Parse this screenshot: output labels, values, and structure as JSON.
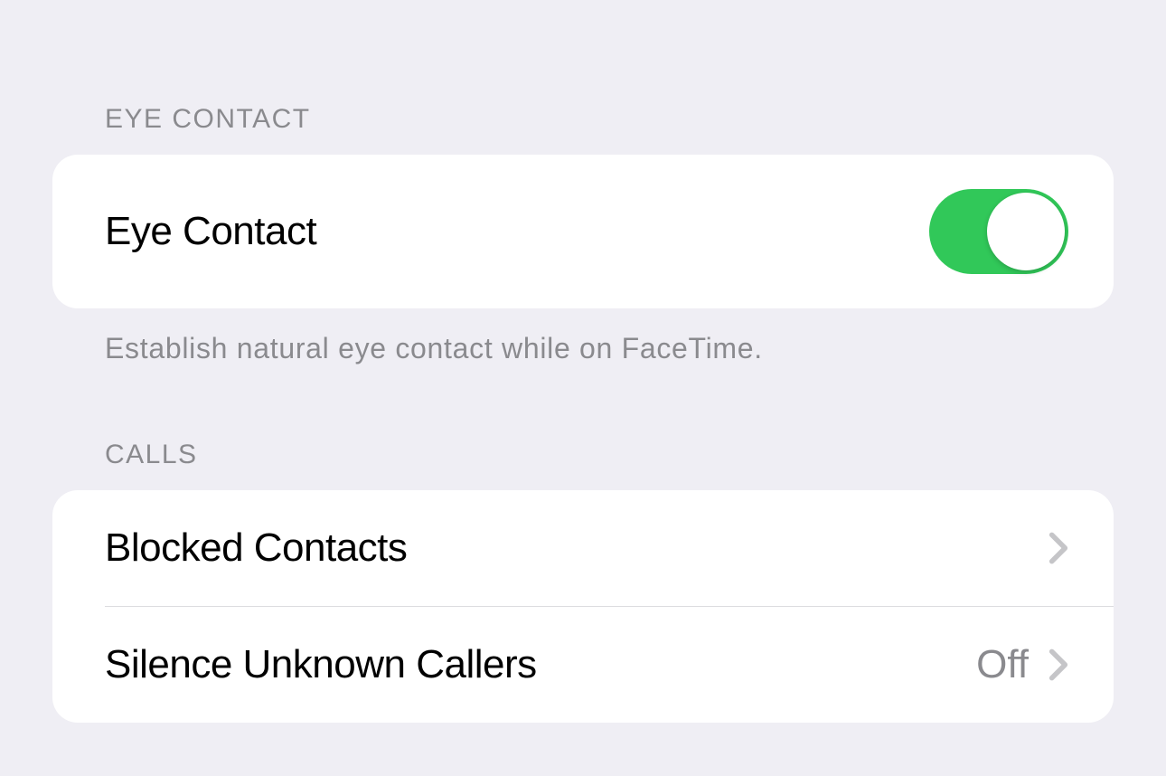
{
  "sections": {
    "eyeContact": {
      "header": "EYE CONTACT",
      "row": {
        "label": "Eye Contact",
        "toggleOn": true
      },
      "footer": "Establish natural eye contact while on FaceTime."
    },
    "calls": {
      "header": "CALLS",
      "rows": [
        {
          "label": "Blocked Contacts",
          "value": ""
        },
        {
          "label": "Silence Unknown Callers",
          "value": "Off"
        }
      ]
    }
  }
}
